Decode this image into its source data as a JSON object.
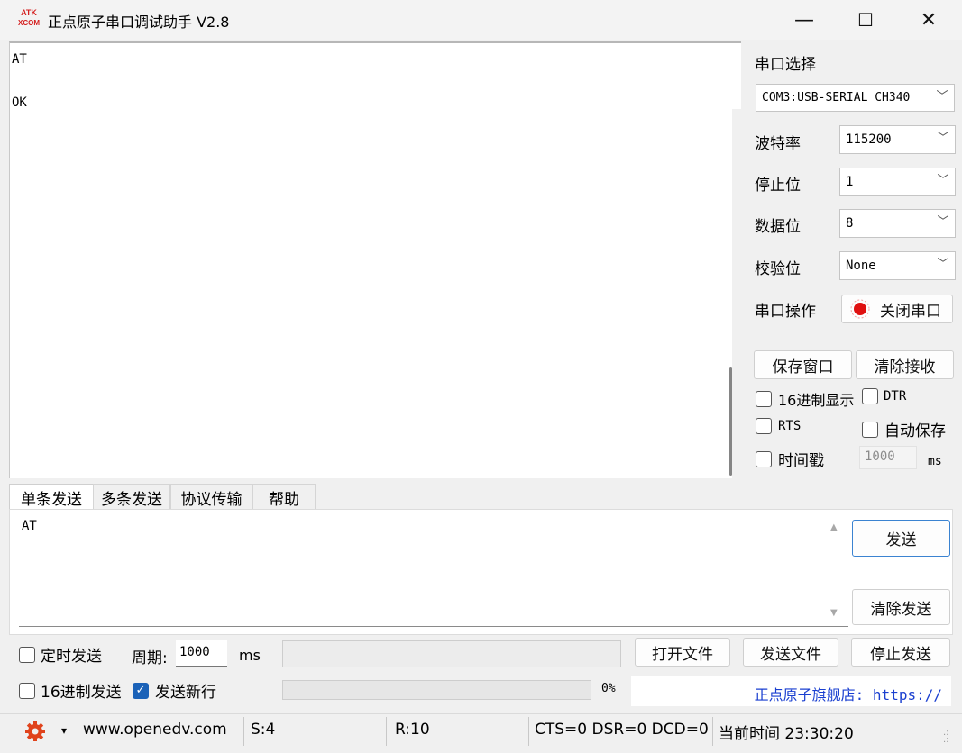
{
  "window": {
    "logo_text_top": "ATK",
    "logo_text_bottom": "XCOM",
    "title": "正点原子串口调试助手 V2.8",
    "minimize_label": "—",
    "maximize_label": "☐",
    "close_label": "✕"
  },
  "receive": {
    "text": "AT\n\nOK"
  },
  "port": {
    "section_label": "串口选择",
    "selected_port": "COM3:USB-SERIAL CH340",
    "baud_label": "波特率",
    "baud_value": "115200",
    "stop_label": "停止位",
    "stop_value": "1",
    "data_label": "数据位",
    "data_value": "8",
    "parity_label": "校验位",
    "parity_value": "None",
    "operation_label": "串口操作",
    "close_port_label": "关闭串口",
    "indicator_color": "#e01010"
  },
  "receive_options": {
    "save_window_label": "保存窗口",
    "clear_receive_label": "清除接收",
    "hex_display_label": "16进制显示",
    "dtr_label": "DTR",
    "rts_label": "RTS",
    "auto_save_label": "自动保存",
    "timestamp_label": "时间戳",
    "timestamp_value": "1000",
    "timestamp_unit": "ms"
  },
  "tabs": [
    {
      "label": "单条发送",
      "active": true
    },
    {
      "label": "多条发送",
      "active": false
    },
    {
      "label": "协议传输",
      "active": false
    },
    {
      "label": "帮助",
      "active": false
    }
  ],
  "send": {
    "text": "AT",
    "send_label": "发送",
    "clear_send_label": "清除发送",
    "timed_send_label": "定时发送",
    "period_label": "周期:",
    "period_value": "1000",
    "period_unit": "ms",
    "open_file_label": "打开文件",
    "send_file_label": "发送文件",
    "stop_send_label": "停止发送",
    "hex_send_label": "16进制发送",
    "new_line_label": "发送新行",
    "new_line_checked": true,
    "progress_text": "0%",
    "progress_value": 0,
    "store_link": "正点原子旗舰店: https://"
  },
  "status": {
    "website": "www.openedv.com",
    "sent": "S:4",
    "received": "R:10",
    "signals": "CTS=0 DSR=0 DCD=0",
    "time": "当前时间 23:30:20"
  }
}
